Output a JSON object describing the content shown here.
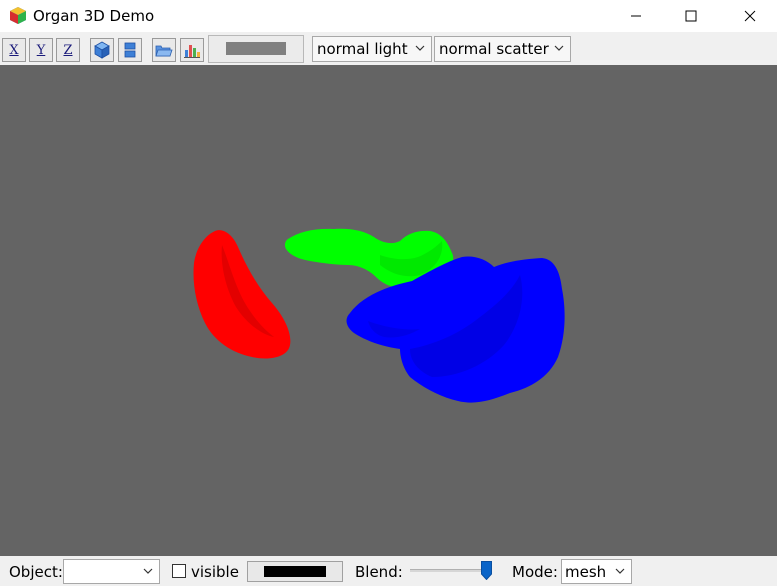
{
  "window": {
    "title": "Organ 3D Demo",
    "icons": {
      "app": "organ-app-icon",
      "minimize": "minimize-icon",
      "maximize": "maximize-icon",
      "close": "close-icon"
    }
  },
  "toolbar": {
    "buttons": [
      {
        "label": "X",
        "icon": "view-x-axis-icon"
      },
      {
        "label": "Y",
        "icon": "view-y-axis-icon"
      },
      {
        "label": "Z",
        "icon": "view-z-axis-icon"
      },
      {
        "label": "",
        "icon": "cube-icon"
      },
      {
        "label": "",
        "icon": "layers-icon"
      },
      {
        "label": "",
        "icon": "open-folder-icon"
      },
      {
        "label": "",
        "icon": "bar-chart-icon"
      }
    ],
    "background_color": "#808080",
    "light_mode": "normal light",
    "scatter_mode": "normal scatter"
  },
  "viewport": {
    "background": "#646464",
    "organs": [
      {
        "color": "#ff0000"
      },
      {
        "color": "#00ff00"
      },
      {
        "color": "#0000ff"
      }
    ]
  },
  "bottombar": {
    "object_label": "Object:",
    "object_value": "",
    "visible_label": "visible",
    "visible_checked": false,
    "object_color": "#000000",
    "blend_label": "Blend:",
    "blend_value": 0.93,
    "mode_label": "Mode:",
    "mode_value": "mesh"
  }
}
